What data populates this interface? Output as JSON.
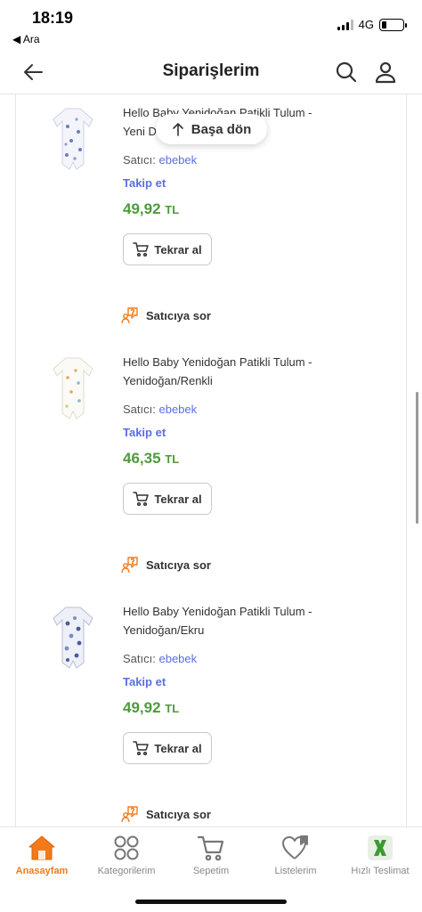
{
  "status": {
    "time": "18:19",
    "back_app": "◀ Ara",
    "network": "4G",
    "battery_level": 0.22
  },
  "header": {
    "title": "Siparişlerim"
  },
  "back_to_top": {
    "label": "Başa dön"
  },
  "products": [
    {
      "name": "Hello Baby Yenidoğan Patikli Tulum - Yeni Doğan/Gri",
      "seller_label": "Satıcı:",
      "seller": "ebebek",
      "follow": "Takip et",
      "price": "49,92",
      "currency": "TL",
      "reorder": "Tekrar al",
      "ask": "Satıcıya sor"
    },
    {
      "name": "Hello Baby Yenidoğan Patikli Tulum - Yenidoğan/Renkli",
      "seller_label": "Satıcı:",
      "seller": "ebebek",
      "follow": "Takip et",
      "price": "46,35",
      "currency": "TL",
      "reorder": "Tekrar al",
      "ask": "Satıcıya sor"
    },
    {
      "name": "Hello Baby Yenidoğan Patikli Tulum - Yenidoğan/Ekru",
      "seller_label": "Satıcı:",
      "seller": "ebebek",
      "follow": "Takip et",
      "price": "49,92",
      "currency": "TL",
      "reorder": "Tekrar al",
      "ask": "Satıcıya sor"
    }
  ],
  "nav": [
    {
      "label": "Anasayfam",
      "icon": "home-icon",
      "active": true
    },
    {
      "label": "Kategorilerim",
      "icon": "categories-icon",
      "active": false
    },
    {
      "label": "Sepetim",
      "icon": "cart-icon",
      "active": false
    },
    {
      "label": "Listelerim",
      "icon": "heart-list-icon",
      "active": false
    },
    {
      "label": "Hızlı Teslimat",
      "icon": "fast-delivery-icon",
      "active": false
    }
  ],
  "colors": {
    "accent": "#f27a1a",
    "link": "#5b6ee1",
    "price": "#4e9a3c"
  }
}
